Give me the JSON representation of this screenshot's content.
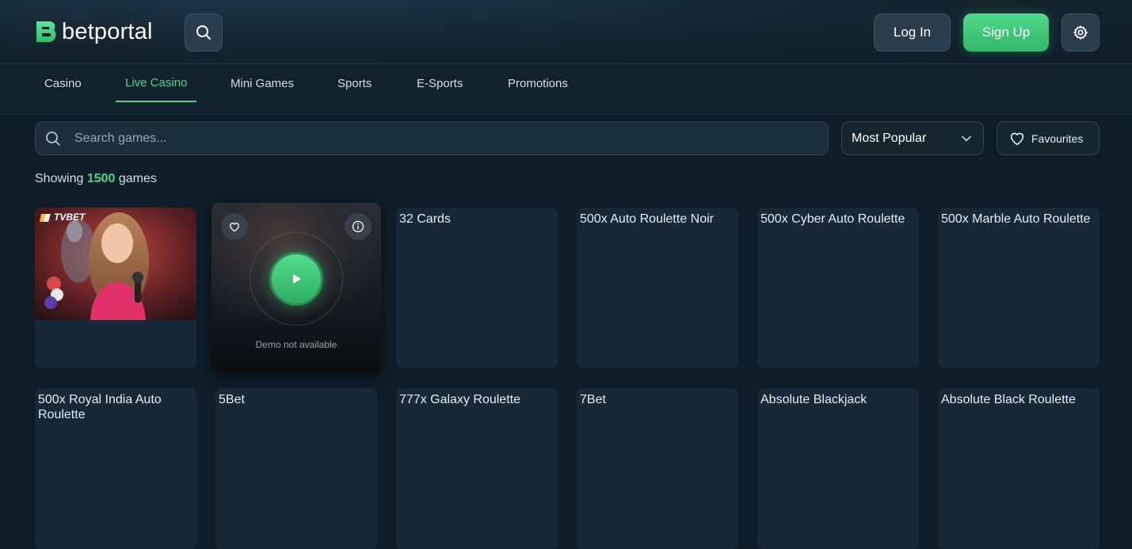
{
  "brand": {
    "name": "betportal",
    "accent": "#4fd68a"
  },
  "header": {
    "login_label": "Log In",
    "signup_label": "Sign Up"
  },
  "nav": {
    "tabs": [
      {
        "label": "Casino",
        "active": false
      },
      {
        "label": "Live Casino",
        "active": true
      },
      {
        "label": "Mini Games",
        "active": false
      },
      {
        "label": "Sports",
        "active": false
      },
      {
        "label": "E-Sports",
        "active": false
      },
      {
        "label": "Promotions",
        "active": false
      }
    ]
  },
  "filters": {
    "search_placeholder": "Search games...",
    "sort_selected": "Most Popular",
    "favourites_label": "Favourites"
  },
  "results": {
    "prefix": "Showing",
    "count": "1500",
    "suffix": "games"
  },
  "games": [
    {
      "title": "",
      "provider_badge": "TVBET",
      "has_image": true
    },
    {
      "title": "",
      "hover": true,
      "demo_text": "Demo not available"
    },
    {
      "title": "32 Cards"
    },
    {
      "title": "500x Auto Roulette Noir"
    },
    {
      "title": "500x Cyber Auto Roulette"
    },
    {
      "title": "500x Marble Auto Roulette"
    },
    {
      "title": "500x Royal India Auto Roulette"
    },
    {
      "title": "5Bet"
    },
    {
      "title": "777x Galaxy Roulette"
    },
    {
      "title": "7Bet"
    },
    {
      "title": "Absolute Blackjack"
    },
    {
      "title": "Absolute Black Roulette"
    }
  ],
  "icons": {
    "search": "search-icon",
    "settings": "gear-icon",
    "heart": "heart-icon",
    "info": "info-icon",
    "play": "play-icon",
    "chevron": "chevron-down-icon"
  }
}
